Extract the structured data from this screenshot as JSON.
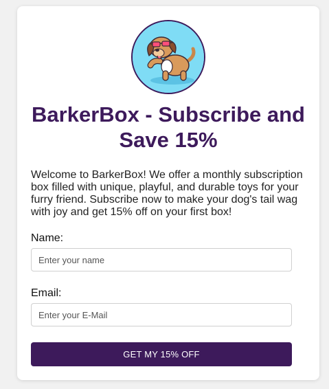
{
  "brand": {
    "logo_icon": "dog-with-sunglasses-icon",
    "primary_color": "#3d1a5b",
    "logo_bg_color": "#7fdcf5"
  },
  "header": {
    "title": "BarkerBox - Subscribe and Save 15%"
  },
  "intro": {
    "text": "Welcome to BarkerBox! We offer a monthly subscription box filled with unique, playful, and durable toys for your furry friend. Subscribe now to make your dog's tail wag with joy and get 15% off on your first box!"
  },
  "form": {
    "name_label": "Name:",
    "name_placeholder": "Enter your name",
    "name_value": "",
    "email_label": "Email:",
    "email_placeholder": "Enter your E-Mail",
    "email_value": "",
    "submit_label": "GET MY 15% OFF"
  }
}
